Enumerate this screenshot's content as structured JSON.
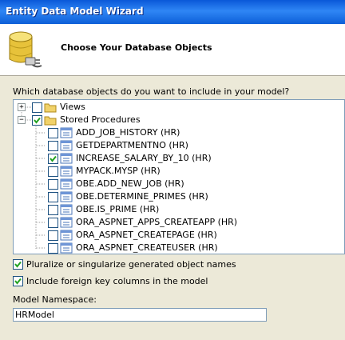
{
  "window": {
    "title": "Entity Data Model Wizard"
  },
  "header": {
    "title": "Choose Your Database Objects"
  },
  "prompt": "Which database objects do you want to include in your model?",
  "tree": {
    "views": {
      "label": "Views",
      "checked": false,
      "expander": "+"
    },
    "stored_procedures": {
      "label": "Stored Procedures",
      "checked": true,
      "expander": "−",
      "items": [
        {
          "label": "ADD_JOB_HISTORY (HR)",
          "checked": false
        },
        {
          "label": "GETDEPARTMENTNO (HR)",
          "checked": false
        },
        {
          "label": "INCREASE_SALARY_BY_10 (HR)",
          "checked": true
        },
        {
          "label": "MYPACK.MYSP (HR)",
          "checked": false
        },
        {
          "label": "OBE.ADD_NEW_JOB (HR)",
          "checked": false
        },
        {
          "label": "OBE.DETERMINE_PRIMES (HR)",
          "checked": false
        },
        {
          "label": "OBE.IS_PRIME (HR)",
          "checked": false
        },
        {
          "label": "ORA_ASPNET_APPS_CREATEAPP (HR)",
          "checked": false
        },
        {
          "label": "ORA_ASPNET_CREATEPAGE (HR)",
          "checked": false
        },
        {
          "label": "ORA_ASPNET_CREATEUSER (HR)",
          "checked": false
        }
      ]
    }
  },
  "options": {
    "pluralize": {
      "label": "Pluralize or singularize generated object names",
      "checked": true
    },
    "foreign_keys": {
      "label": "Include foreign key columns in the model",
      "checked": true
    }
  },
  "namespace": {
    "label": "Model Namespace:",
    "value": "HRModel"
  },
  "colors": {
    "titlebar": "#0a58d8",
    "dialog_bg": "#ece9d8",
    "check": "#21a121",
    "tree_border": "#7f9db9"
  },
  "icons": {
    "header": "database-connection-icon",
    "folder": "folder-icon",
    "procedure": "stored-procedure-icon"
  }
}
